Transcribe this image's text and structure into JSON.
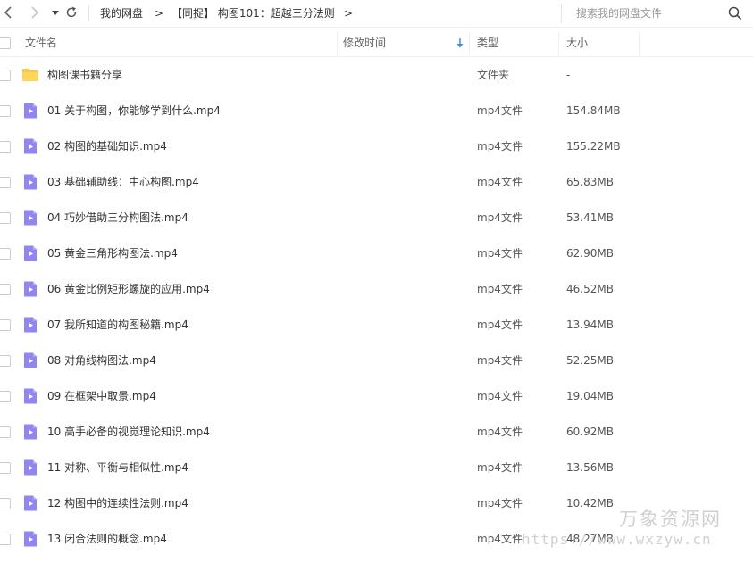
{
  "nav": {
    "breadcrumb": [
      "我的网盘",
      "【同捉】 构图101：超越三分法则"
    ],
    "separator": ">"
  },
  "search": {
    "placeholder": "搜索我的网盘文件"
  },
  "columns": {
    "name": "文件名",
    "modified": "修改时间",
    "type": "类型",
    "size": "大小"
  },
  "files": [
    {
      "name": "构图课书籍分享",
      "type": "文件夹",
      "size": "-",
      "icon": "folder-icon"
    },
    {
      "name": "01 关于构图，你能够学到什么.mp4",
      "type": "mp4文件",
      "size": "154.84MB",
      "icon": "video-file-icon"
    },
    {
      "name": "02 构图的基础知识.mp4",
      "type": "mp4文件",
      "size": "155.22MB",
      "icon": "video-file-icon"
    },
    {
      "name": "03 基础辅助线：中心构图.mp4",
      "type": "mp4文件",
      "size": "65.83MB",
      "icon": "video-file-icon"
    },
    {
      "name": "04 巧妙借助三分构图法.mp4",
      "type": "mp4文件",
      "size": "53.41MB",
      "icon": "video-file-icon"
    },
    {
      "name": "05 黄金三角形构图法.mp4",
      "type": "mp4文件",
      "size": "62.90MB",
      "icon": "video-file-icon"
    },
    {
      "name": "06 黄金比例矩形螺旋的应用.mp4",
      "type": "mp4文件",
      "size": "46.52MB",
      "icon": "video-file-icon"
    },
    {
      "name": "07 我所知道的构图秘籍.mp4",
      "type": "mp4文件",
      "size": "13.94MB",
      "icon": "video-file-icon"
    },
    {
      "name": "08 对角线构图法.mp4",
      "type": "mp4文件",
      "size": "52.25MB",
      "icon": "video-file-icon"
    },
    {
      "name": "09 在框架中取景.mp4",
      "type": "mp4文件",
      "size": "19.04MB",
      "icon": "video-file-icon"
    },
    {
      "name": "10 高手必备的视觉理论知识.mp4",
      "type": "mp4文件",
      "size": "60.92MB",
      "icon": "video-file-icon"
    },
    {
      "name": "11 对称、平衡与相似性.mp4",
      "type": "mp4文件",
      "size": "13.56MB",
      "icon": "video-file-icon"
    },
    {
      "name": "12 构图中的连续性法则.mp4",
      "type": "mp4文件",
      "size": "10.42MB",
      "icon": "video-file-icon"
    },
    {
      "name": "13 闭合法则的概念.mp4",
      "type": "mp4文件",
      "size": "48.27MB",
      "icon": "video-file-icon"
    }
  ],
  "watermark": {
    "title": "万象资源网",
    "url": "https://www.wxzyw.cn"
  },
  "colors": {
    "folder": "#f7c84a",
    "video": "#8f86f0",
    "sort_arrow": "#3a8ee6"
  }
}
